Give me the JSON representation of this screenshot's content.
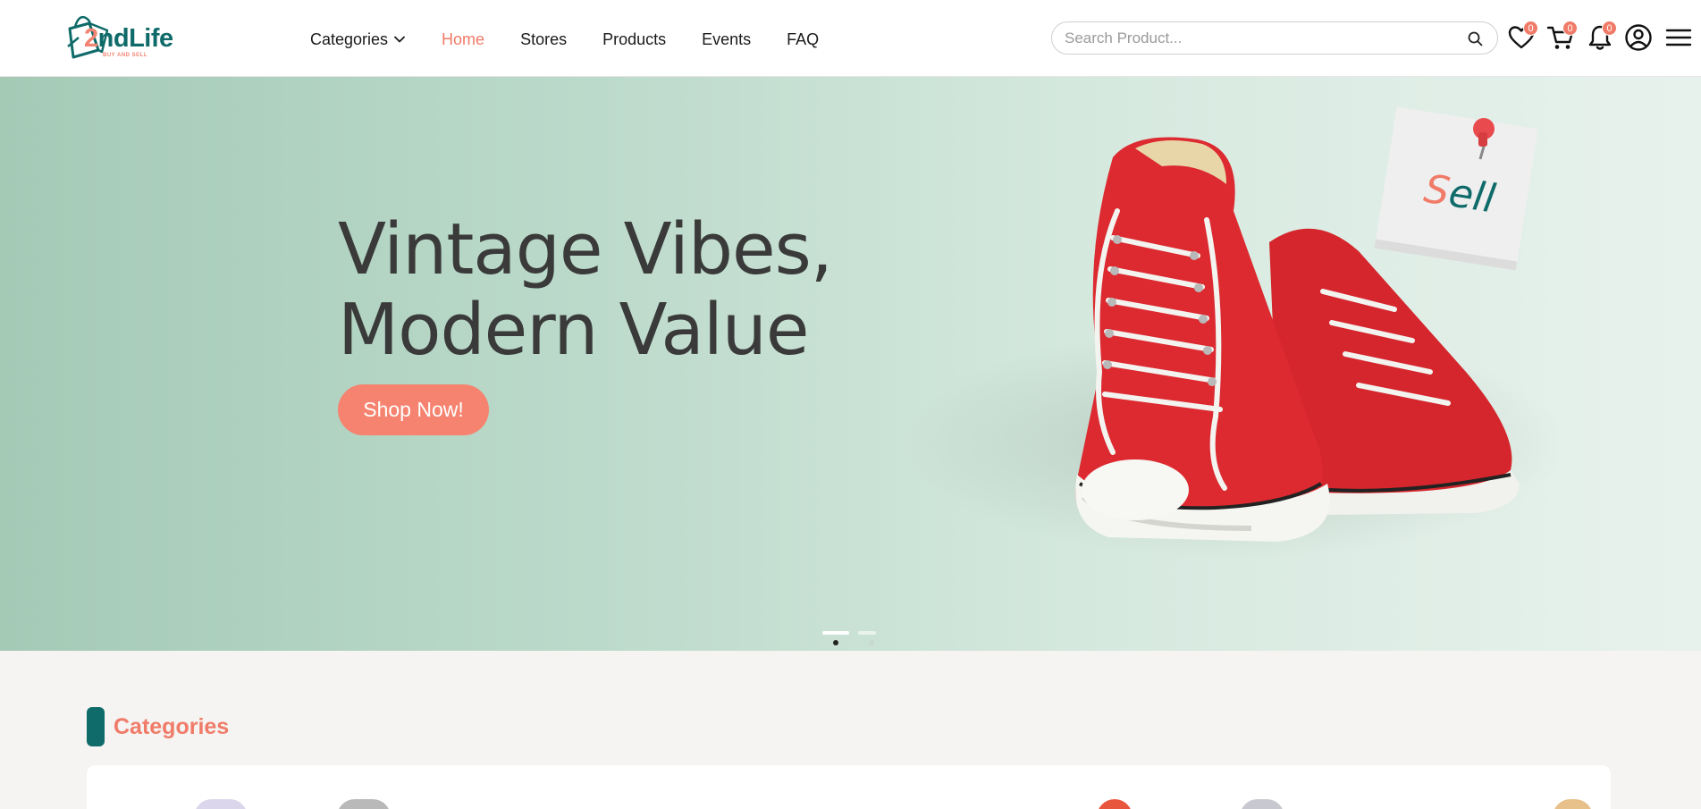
{
  "brand": {
    "name_prefix": "2",
    "name_rest": "ndLife",
    "tagline": "BUY AND SELL"
  },
  "nav": {
    "items": [
      {
        "label": "Categories",
        "has_dropdown": true,
        "active": false
      },
      {
        "label": "Home",
        "active": true
      },
      {
        "label": "Stores",
        "active": false
      },
      {
        "label": "Products",
        "active": false
      },
      {
        "label": "Events",
        "active": false
      },
      {
        "label": "FAQ",
        "active": false
      }
    ]
  },
  "search": {
    "placeholder": "Search Product...",
    "value": ""
  },
  "header_icons": {
    "wishlist": {
      "icon": "heart-icon",
      "count": "0"
    },
    "cart": {
      "icon": "cart-icon",
      "count": "0"
    },
    "notifications": {
      "icon": "bell-icon",
      "count": "0"
    },
    "account": {
      "icon": "user-circle-icon"
    },
    "menu": {
      "icon": "hamburger-icon"
    }
  },
  "hero": {
    "title_line1": "Vintage Vibes,",
    "title_line2": "Modern Value",
    "cta_label": "Shop Now!",
    "note_text": "Sell",
    "slides": 2,
    "active_slide": 1
  },
  "categories_section": {
    "title": "Categories"
  },
  "colors": {
    "brand_teal": "#0f6b69",
    "accent_coral": "#f07b68",
    "button_coral": "#f5836f",
    "hero_left": "#a4cab6",
    "hero_right": "#e8f2ed"
  }
}
